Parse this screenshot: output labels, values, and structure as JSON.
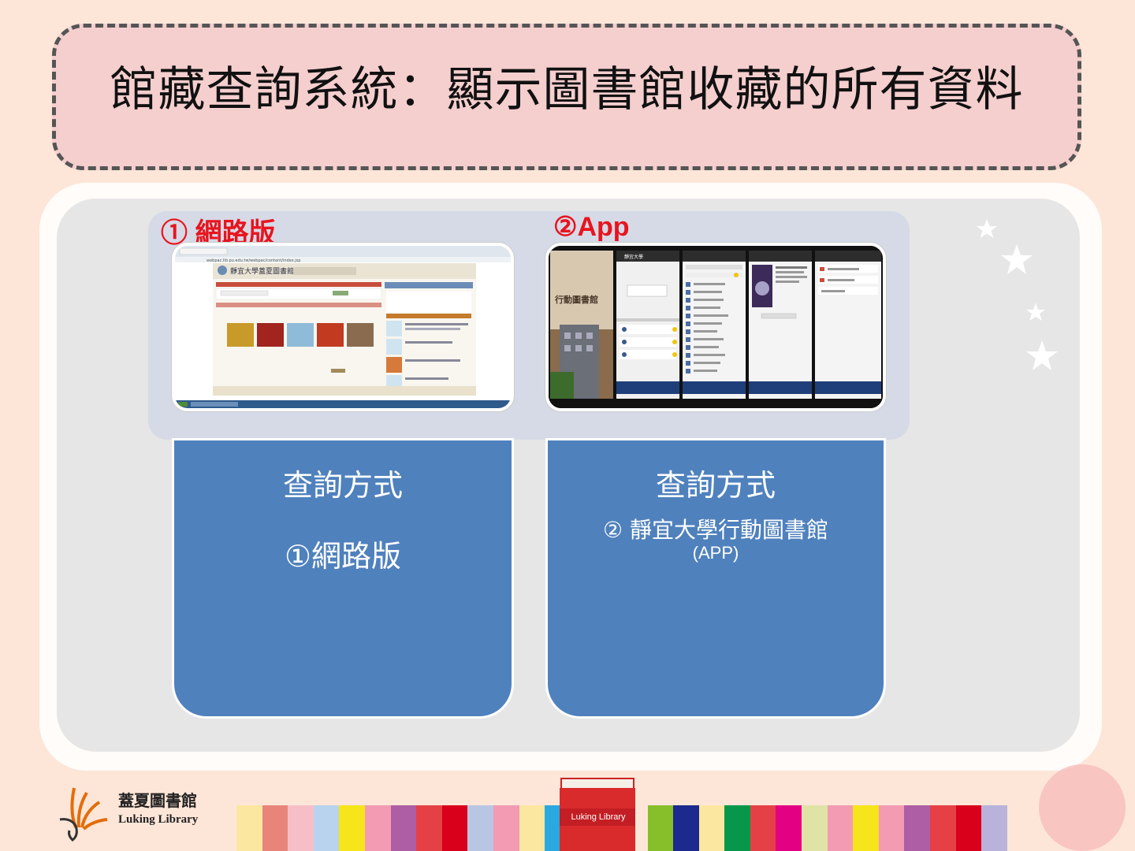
{
  "title": "館藏查詢系統：顯示圖書館收藏的所有資料",
  "labels": {
    "web": "① 網路版",
    "app": "②App"
  },
  "cards": {
    "web": {
      "heading": "查詢方式",
      "item": "①網路版"
    },
    "app": {
      "heading": "查詢方式",
      "item_line1": "② 靜宜大學行動圖書館",
      "item_line2": "(APP)"
    }
  },
  "web_screenshot": {
    "site_title": "靜宜大學蓋夏圖書館",
    "url": "webpac.lib.pu.edu.tw/webpac/content/index.jsp"
  },
  "app_screenshot": {
    "splash_text": "行動圖書館",
    "screen_title": "靜宜大學"
  },
  "logo": {
    "name": "蓋夏圖書館",
    "english": "Luking Library"
  },
  "book_label": "Luking Library",
  "colors": {
    "title_bg": "#f5cece",
    "card_bg": "#4f81bd",
    "label_red": "#e8141e",
    "page_bg": "#fde6d8"
  }
}
